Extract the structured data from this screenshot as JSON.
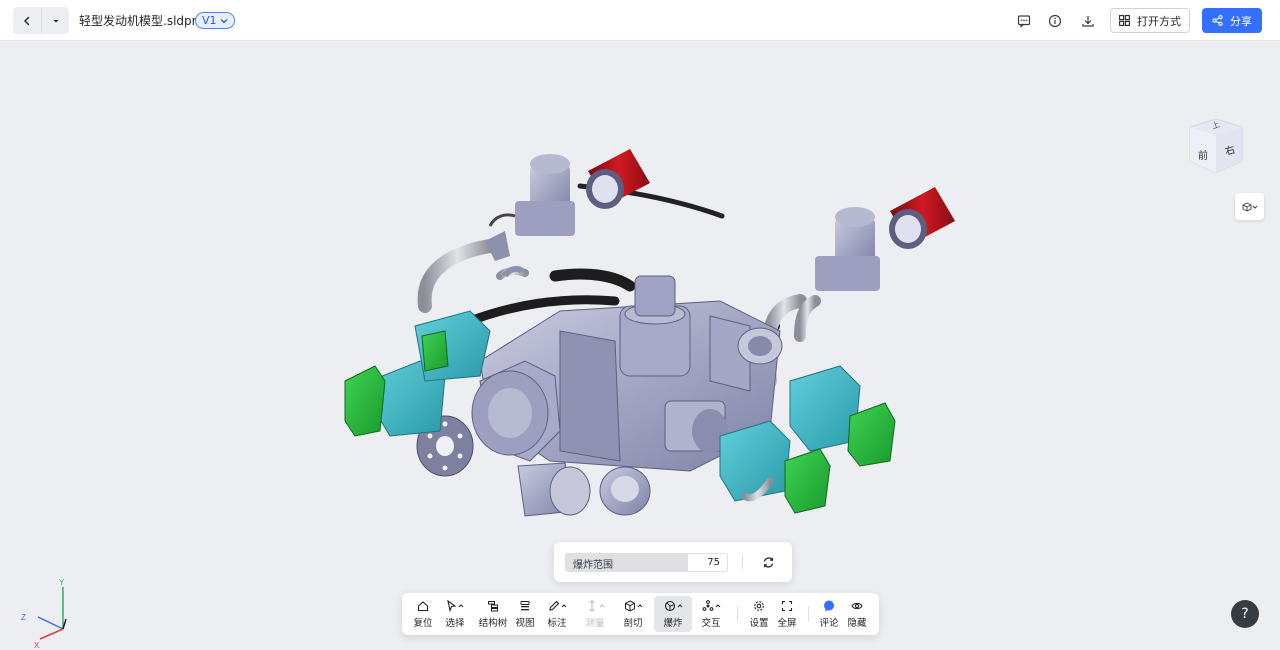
{
  "header": {
    "file_name": "轻型发动机模型.sldprt",
    "version": "V1",
    "open_with_label": "打开方式",
    "share_label": "分享",
    "icons": [
      "back-icon",
      "dropdown-icon",
      "comment-icon",
      "info-icon",
      "download-icon",
      "grid-icon",
      "share-icon"
    ]
  },
  "viewcube": {
    "front_label": "前",
    "right_label": "右",
    "top_label": "上"
  },
  "axes": {
    "x": "X",
    "y": "Y",
    "z": "Z"
  },
  "explode_panel": {
    "label": "爆炸范围",
    "value": "75"
  },
  "toolbar": {
    "tools": [
      {
        "label": "复位",
        "icon": "home-icon"
      },
      {
        "label": "选择",
        "icon": "cursor-icon"
      },
      {
        "label": "结构树",
        "icon": "tree-icon"
      },
      {
        "label": "视图",
        "icon": "view-icon"
      },
      {
        "label": "标注",
        "icon": "pen-icon"
      },
      {
        "label": "测量",
        "icon": "measure-icon",
        "disabled": true
      },
      {
        "label": "剖切",
        "icon": "section-icon"
      },
      {
        "label": "爆炸",
        "icon": "explode-icon",
        "active": true
      },
      {
        "label": "交互",
        "icon": "interact-icon"
      },
      {
        "label": "设置",
        "icon": "gear-icon"
      },
      {
        "label": "全屏",
        "icon": "fullscreen-icon"
      },
      {
        "label": "评论",
        "icon": "comment-dot-icon"
      },
      {
        "label": "隐藏",
        "icon": "eye-icon"
      }
    ]
  },
  "help": {
    "label": "?"
  },
  "colors": {
    "accent": "#3370ff",
    "part_gray": "#9fa2c4",
    "part_cyan": "#3fb6c4",
    "part_green": "#27b43c",
    "part_red": "#b5121b",
    "background": "#edeef2"
  }
}
